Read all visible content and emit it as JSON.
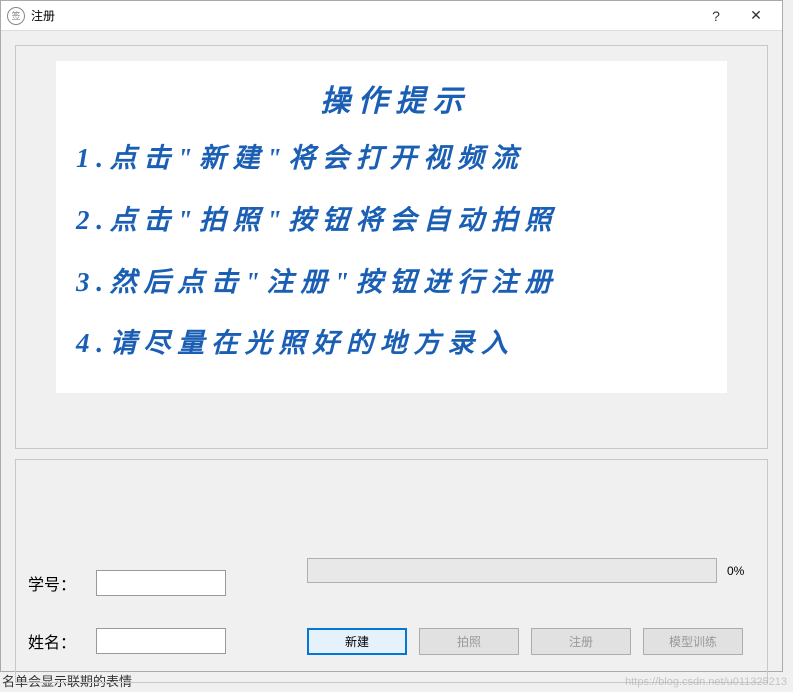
{
  "window": {
    "title": "注册",
    "help_symbol": "?",
    "close_symbol": "✕",
    "icon_symbol": "签"
  },
  "instructions": {
    "title": "操 作 提 示",
    "lines": [
      "1 . 点 击 \" 新 建 \" 将 会 打 开 视 频 流",
      "2 . 点 击 \" 拍 照 \" 按 钮 将 会 自 动 拍 照",
      "3 . 然 后 点 击 \" 注 册 \" 按 钮 进 行 注 册",
      "4 . 请 尽 量 在 光 照 好 的 地 方 录 入"
    ]
  },
  "form": {
    "student_id_label": "学号：",
    "student_id_value": "",
    "name_label": "姓名：",
    "name_value": "",
    "progress_percent": "0%"
  },
  "buttons": {
    "new": "新建",
    "capture": "拍照",
    "register": "注册",
    "train": "模型训练"
  },
  "watermark": "https://blog.csdn.net/u011325213",
  "background_text": "名单会显示联期的表情"
}
